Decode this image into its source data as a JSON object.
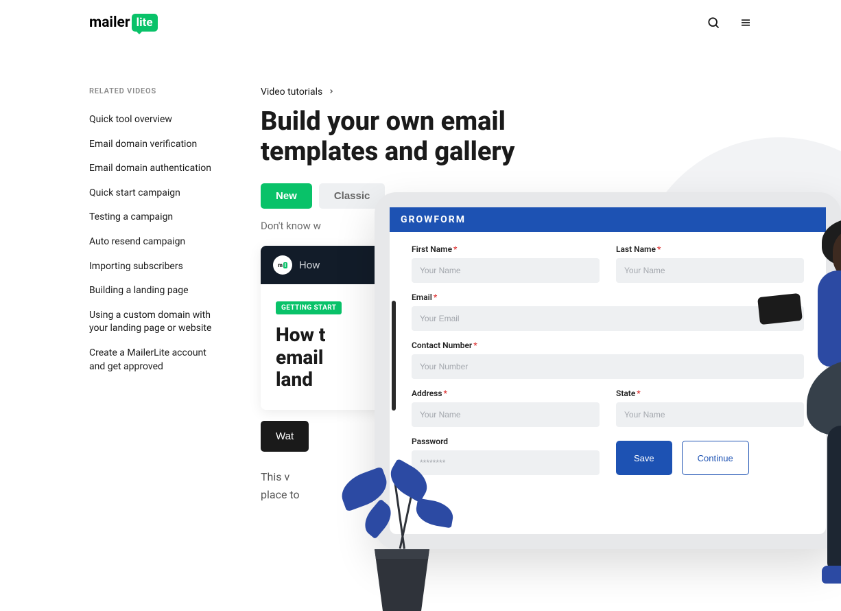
{
  "logo": {
    "main": "mailer",
    "accent": "lite"
  },
  "sidebar": {
    "title": "RELATED VIDEOS",
    "items": [
      "Quick tool overview",
      "Email domain verification",
      "Email domain authentication",
      "Quick start campaign",
      "Testing a campaign",
      "Auto resend campaign",
      "Importing subscribers",
      "Building a landing page",
      "Using a custom domain with your landing page or website",
      "Create a MailerLite account and get approved"
    ]
  },
  "breadcrumb": {
    "root": "Video tutorials"
  },
  "page": {
    "title": "Build your own email templates and gallery",
    "subtext_prefix": "Don't know w",
    "desc_prefix": "This v",
    "desc_line2_prefix": "place to"
  },
  "tabs": {
    "new": "New",
    "classic": "Classic"
  },
  "video": {
    "head": "How",
    "badge": "GETTING START",
    "title_l1": "How t",
    "title_l2": "email",
    "title_l3": "land",
    "watch": "Wat"
  },
  "form": {
    "brand": "GROWFORM",
    "first_name": {
      "label": "First Name",
      "placeholder": "Your Name"
    },
    "last_name": {
      "label": "Last Name",
      "placeholder": "Your Name"
    },
    "email": {
      "label": "Email",
      "placeholder": "Your Email"
    },
    "contact": {
      "label": "Contact Number",
      "placeholder": "Your Number"
    },
    "address": {
      "label": "Address",
      "placeholder": "Your Name"
    },
    "state": {
      "label": "State",
      "placeholder": "Your Name"
    },
    "password": {
      "label": "Password",
      "placeholder": "********"
    },
    "save": "Save",
    "continue": "Continue"
  }
}
